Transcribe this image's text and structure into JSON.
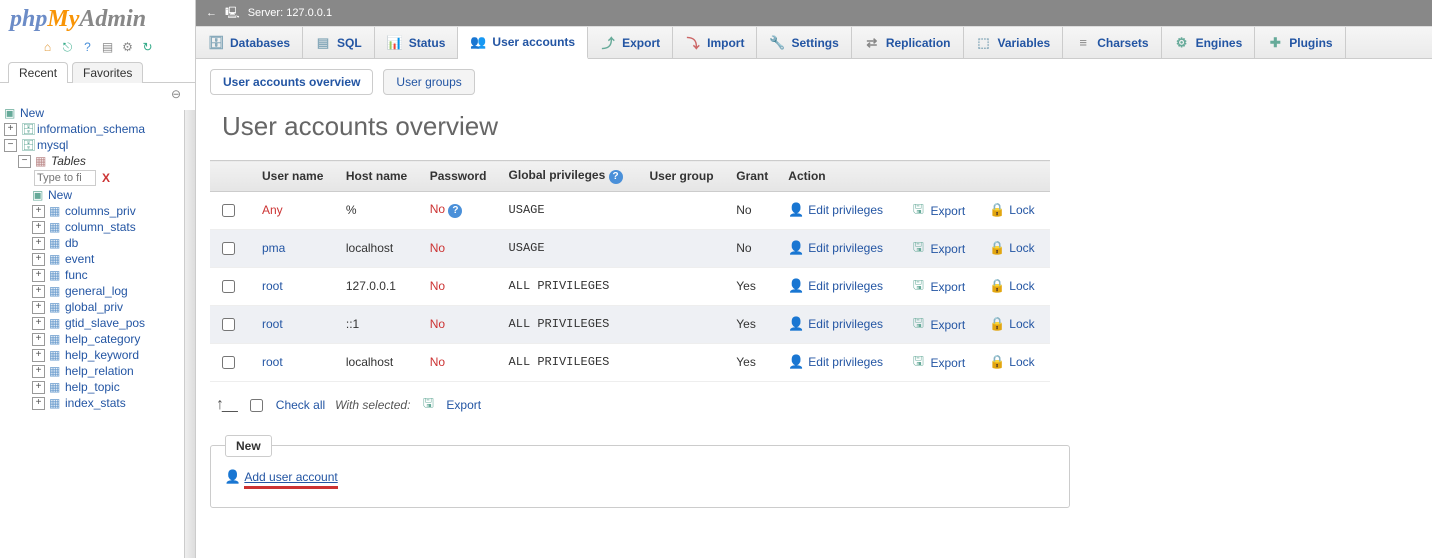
{
  "logo": {
    "p1": "php",
    "p2": "My",
    "p3": "Admin"
  },
  "sidebar": {
    "tabs": [
      "Recent",
      "Favorites"
    ],
    "tree": {
      "new": "New",
      "dbs": [
        "information_schema",
        "mysql"
      ],
      "tables_label": "Tables",
      "filter_placeholder": "Type to fi",
      "filter_clear": "X",
      "tables": [
        "columns_priv",
        "column_stats",
        "db",
        "event",
        "func",
        "general_log",
        "global_priv",
        "gtid_slave_pos",
        "help_category",
        "help_keyword",
        "help_relation",
        "help_topic",
        "index_stats"
      ]
    }
  },
  "header": {
    "server": "Server: 127.0.0.1"
  },
  "menu": [
    "Databases",
    "SQL",
    "Status",
    "User accounts",
    "Export",
    "Import",
    "Settings",
    "Replication",
    "Variables",
    "Charsets",
    "Engines",
    "Plugins"
  ],
  "subtabs": [
    "User accounts overview",
    "User groups"
  ],
  "page": {
    "title": "User accounts overview"
  },
  "table": {
    "headers": [
      "User name",
      "Host name",
      "Password",
      "Global privileges",
      "User group",
      "Grant",
      "Action"
    ],
    "action_labels": {
      "edit": "Edit privileges",
      "export": "Export",
      "lock": "Lock"
    },
    "rows": [
      {
        "user": "Any",
        "user_red": true,
        "host": "%",
        "password": "No",
        "password_help": true,
        "priv": "USAGE",
        "group": "",
        "grant": "No"
      },
      {
        "user": "pma",
        "user_red": false,
        "host": "localhost",
        "password": "No",
        "password_help": false,
        "priv": "USAGE",
        "group": "",
        "grant": "No"
      },
      {
        "user": "root",
        "user_red": false,
        "host": "127.0.0.1",
        "password": "No",
        "password_help": false,
        "priv": "ALL PRIVILEGES",
        "group": "",
        "grant": "Yes"
      },
      {
        "user": "root",
        "user_red": false,
        "host": "::1",
        "password": "No",
        "password_help": false,
        "priv": "ALL PRIVILEGES",
        "group": "",
        "grant": "Yes"
      },
      {
        "user": "root",
        "user_red": false,
        "host": "localhost",
        "password": "No",
        "password_help": false,
        "priv": "ALL PRIVILEGES",
        "group": "",
        "grant": "Yes"
      }
    ]
  },
  "bulk": {
    "check_all": "Check all",
    "with_selected": "With selected:",
    "export": "Export"
  },
  "newbox": {
    "legend": "New",
    "add_user": "Add user account"
  }
}
